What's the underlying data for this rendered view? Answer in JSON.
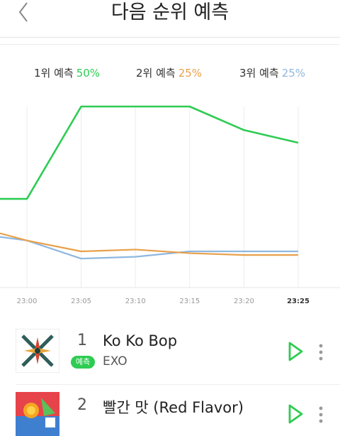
{
  "header": {
    "title": "다음 순위 예측",
    "back_icon": "chevron-left-icon"
  },
  "legend": [
    {
      "label": "1위 예측",
      "pct": "50%",
      "color": "#2ecc52"
    },
    {
      "label": "2위 예측",
      "pct": "25%",
      "color": "#e8a04a"
    },
    {
      "label": "3위 예측",
      "pct": "25%",
      "color": "#8fb8e0"
    }
  ],
  "chart_data": {
    "type": "line",
    "categories": [
      "23:00",
      "23:05",
      "23:10",
      "23:15",
      "23:20",
      "23:25"
    ],
    "series": [
      {
        "name": "1위 예측",
        "color": "#2ecc52",
        "values": [
          49,
          100,
          100,
          100,
          87,
          80
        ]
      },
      {
        "name": "2위 예측",
        "color": "#e8a04a",
        "values": [
          26,
          20,
          21,
          19,
          18,
          18
        ]
      },
      {
        "name": "3위 예측",
        "color": "#8fb8e0",
        "values": [
          26,
          16,
          17,
          20,
          20,
          20
        ]
      }
    ],
    "lead_in": {
      "1위 예측": 49,
      "2위 예측": 30,
      "3위 예측": 28
    },
    "highlight_category": "23:25",
    "grid": true
  },
  "songs": [
    {
      "rank": "1",
      "title": "Ko Ko Bop",
      "artist": "EXO",
      "badge": "예측"
    },
    {
      "rank": "2",
      "title": "빨간 맛 (Red Flavor)"
    }
  ],
  "icons": {
    "play": "play-icon",
    "more": "more-vertical-icon"
  }
}
